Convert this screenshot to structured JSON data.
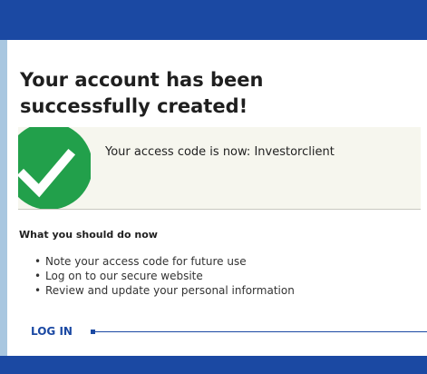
{
  "header": {
    "color": "#1b49a3"
  },
  "confirmation": {
    "title": "Your account has been successfully created!",
    "access_code_message": "Your access code is now: Investorclient",
    "success_color": "#22a04b",
    "icon": "checkmark-icon"
  },
  "next_steps": {
    "heading": "What you should do now",
    "items": [
      "Note your access code for future use",
      "Log on to our secure website",
      "Review and update your personal information"
    ]
  },
  "login": {
    "label": "LOG IN"
  }
}
